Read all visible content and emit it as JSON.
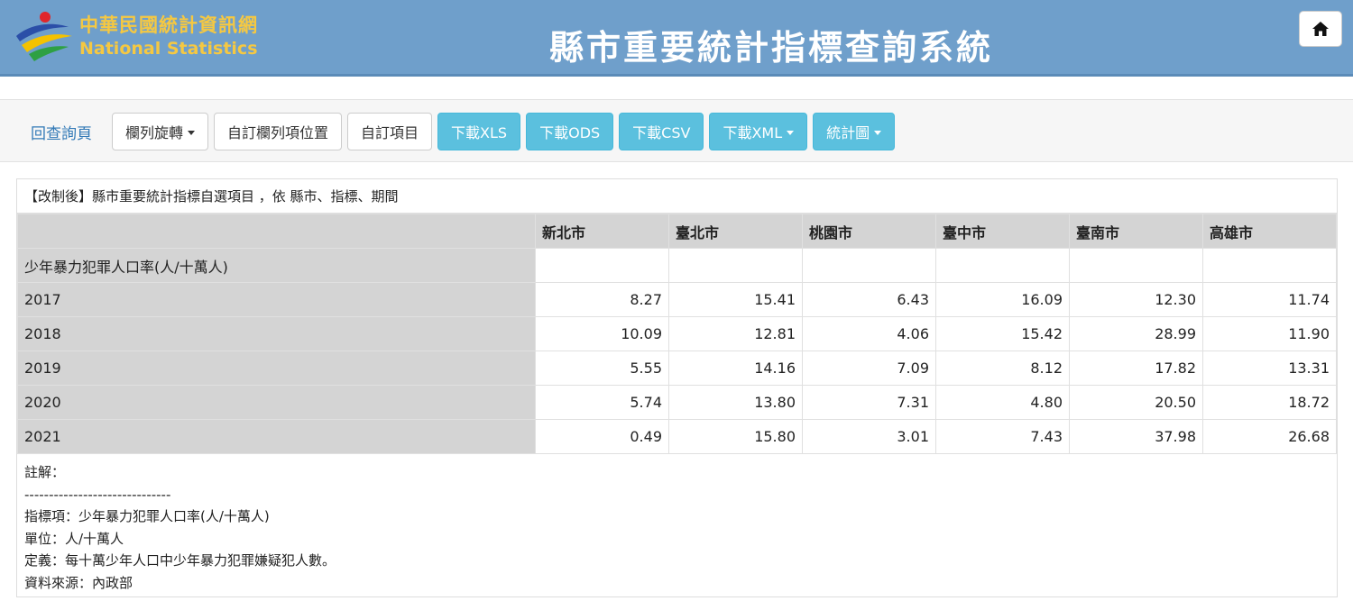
{
  "header": {
    "logo_zh": "中華民國統計資訊網",
    "logo_en": "National Statistics",
    "title": "縣市重要統計指標查詢系統",
    "home_icon": "home-icon"
  },
  "toolbar": {
    "back_link": "回查詢頁",
    "buttons": [
      {
        "label": "欄列旋轉",
        "style": "default",
        "caret": true
      },
      {
        "label": "自訂欄列項位置",
        "style": "default",
        "caret": false
      },
      {
        "label": "自訂項目",
        "style": "default",
        "caret": false
      },
      {
        "label": "下載XLS",
        "style": "info",
        "caret": false
      },
      {
        "label": "下載ODS",
        "style": "info",
        "caret": false
      },
      {
        "label": "下載CSV",
        "style": "info",
        "caret": false
      },
      {
        "label": "下載XML",
        "style": "info",
        "caret": true
      },
      {
        "label": "統計圖",
        "style": "info",
        "caret": true
      }
    ]
  },
  "report": {
    "caption": "【改制後】縣市重要統計指標自選項目 ，依 縣市、指標、期間",
    "columns": [
      "新北市",
      "臺北市",
      "桃園市",
      "臺中市",
      "臺南市",
      "高雄市"
    ],
    "indicator_row": "少年暴力犯罪人口率(人/十萬人)",
    "rows": [
      {
        "year": "2017",
        "values": [
          "8.27",
          "15.41",
          "6.43",
          "16.09",
          "12.30",
          "11.74"
        ]
      },
      {
        "year": "2018",
        "values": [
          "10.09",
          "12.81",
          "4.06",
          "15.42",
          "28.99",
          "11.90"
        ]
      },
      {
        "year": "2019",
        "values": [
          "5.55",
          "14.16",
          "7.09",
          "8.12",
          "17.82",
          "13.31"
        ]
      },
      {
        "year": "2020",
        "values": [
          "5.74",
          "13.80",
          "7.31",
          "4.80",
          "20.50",
          "18.72"
        ]
      },
      {
        "year": "2021",
        "values": [
          "0.49",
          "15.80",
          "3.01",
          "7.43",
          "37.98",
          "26.68"
        ]
      }
    ],
    "notes": [
      "註解：",
      "------------------------------",
      "指標項：少年暴力犯罪人口率(人/十萬人)",
      "單位：人/十萬人",
      "定義：每十萬少年人口中少年暴力犯罪嫌疑犯人數。",
      "資料來源：內政部"
    ]
  },
  "colors": {
    "header_bg": "#6f9fcb",
    "logo_text": "#f5c842",
    "info_button": "#5bc0de",
    "link": "#337ab7",
    "row_head_bg": "#d4d4d4"
  }
}
